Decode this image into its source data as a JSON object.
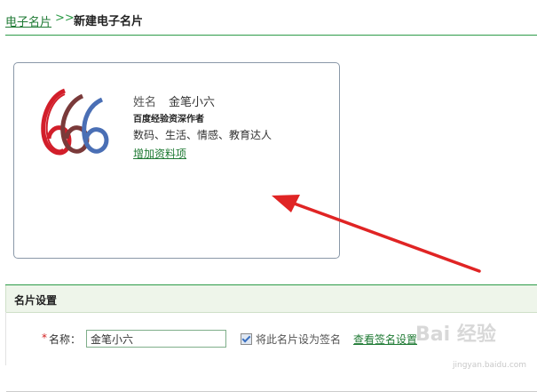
{
  "breadcrumb": {
    "parent": "电子名片",
    "separator": ">>",
    "current": "新建电子名片"
  },
  "card": {
    "logo_icon": "baidu-jingyan-666-logo",
    "name_label": "姓名",
    "name_value": "金笔小六",
    "title": "百度经验资深作者",
    "tags": "数码、生活、情感、教育达人",
    "add_link": "增加资料项"
  },
  "settings": {
    "title": "名片设置",
    "required_mark": "*",
    "name_field_label": "名称：",
    "name_field_value": "金笔小六",
    "set_as_signature_checked": true,
    "set_as_signature_label": "将此名片设为签名",
    "view_signature_link": "查看签名设置"
  },
  "watermark": {
    "text": "Bai 经验",
    "sub": "jingyan.baidu.com"
  },
  "colors": {
    "accent_green": "#2e9b48",
    "link_green": "#1f7a34",
    "arrow_red": "#e02424",
    "logo_red": "#d21e2a",
    "logo_brown": "#7a3a3a",
    "logo_blue": "#4a6fb5"
  }
}
